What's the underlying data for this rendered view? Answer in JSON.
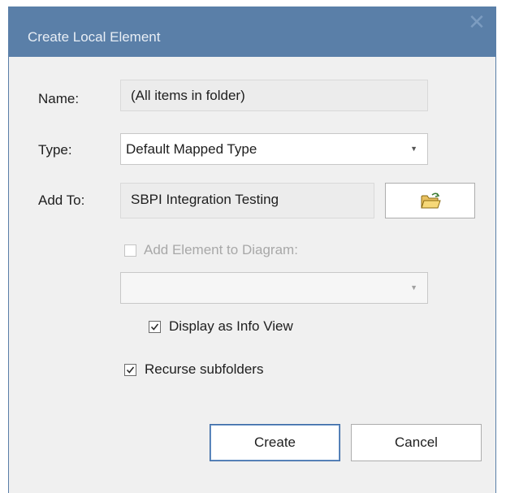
{
  "dialog": {
    "title": "Create Local Element",
    "close_glyph": "✕"
  },
  "form": {
    "name_label": "Name:",
    "name_value": "(All items in folder)",
    "type_label": "Type:",
    "type_value": "Default Mapped Type",
    "addto_label": "Add To:",
    "addto_value": "SBPI Integration Testing",
    "add_to_diagram_label": "Add Element to Diagram:",
    "add_to_diagram_checked": false,
    "add_to_diagram_enabled": false,
    "diagram_value": "",
    "info_view_label": "Display as Info View",
    "info_view_checked": true,
    "recurse_label": "Recurse subfolders",
    "recurse_checked": true
  },
  "buttons": {
    "create": "Create",
    "cancel": "Cancel"
  },
  "icons": {
    "browse": "folder-icon",
    "dropdown": "chevron-down-icon",
    "check": "checkmark-icon"
  }
}
